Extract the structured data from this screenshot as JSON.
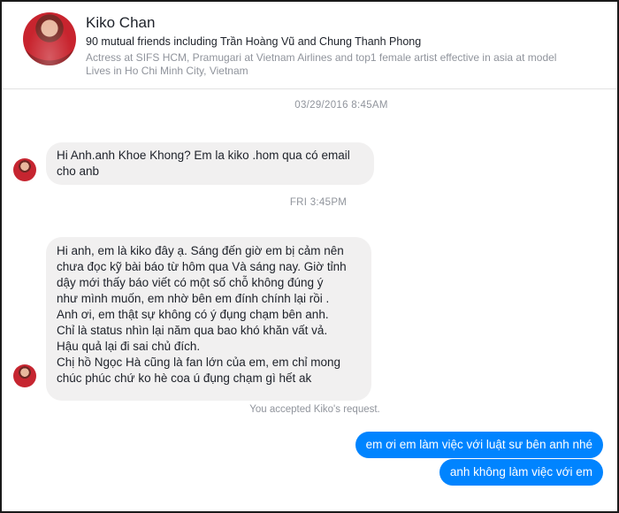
{
  "profile": {
    "name": "Kiko Chan",
    "mutual_friends": "90 mutual friends including Trần Hoàng Vũ and Chung Thanh Phong",
    "bio_line1": "Actress at SIFS HCM, Pramugari at Vietnam Airlines and top1 female artist effective in asia at model",
    "bio_line2": "Lives in Ho Chi Minh City, Vietnam"
  },
  "timestamps": {
    "first": "03/29/2016 8:45AM",
    "second": "FRI 3:45PM"
  },
  "messages": {
    "incoming1": "Hi Anh.anh Khoe Khong? Em la kiko .hom qua có email\ncho anb",
    "incoming2": "Hi anh, em là kiko đây ạ. Sáng đến giờ em bị cảm nên\nchưa đọc kỹ bài báo từ hôm qua Và sáng nay. Giờ tỉnh\ndậy mới thấy báo viết có một số chỗ không đúng ý\nnhư mình muốn, em nhờ bên em đính chính lại rồi .\nAnh ơi, em thật sự không có ý đụng chạm bên anh.\nChỉ là status nhìn lại năm qua bao khó khăn vất vả.\nHậu quả lại đi sai chủ đích.\nChị hồ Ngọc Hà cũng là fan lớn của em, em chỉ mong\nchúc phúc chứ ko hè coa ú đụng chạm gì hết ak",
    "outgoing1": "em ơi em làm việc với luật sư bên anh nhé",
    "outgoing2": "anh không làm việc với em"
  },
  "notice": "You accepted Kiko's request.",
  "colors": {
    "outgoing_bubble": "#0084ff",
    "incoming_bubble": "#f1f0f0",
    "meta_text": "#90949c"
  }
}
